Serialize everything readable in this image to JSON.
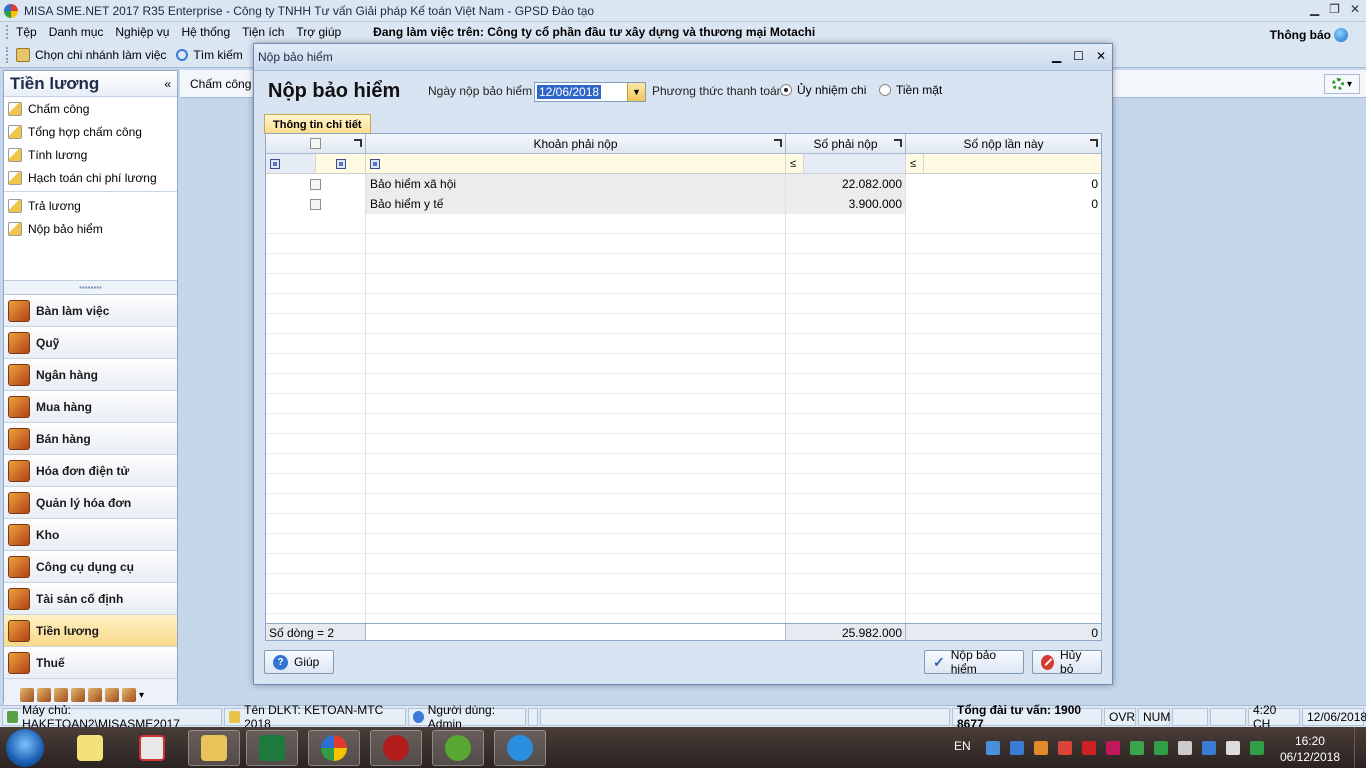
{
  "window": {
    "title": "MISA SME.NET 2017 R35 Enterprise - Công ty TNHH Tư vấn Giải pháp Kế toán Việt Nam - GPSD Đào tạo"
  },
  "menu": {
    "items": [
      "Tệp",
      "Danh mục",
      "Nghiệp vụ",
      "Hệ thống",
      "Tiện ích",
      "Trợ giúp"
    ],
    "workspace": "Đang làm việc trên:  Công ty cổ phần đầu tư xây dựng và thương mại Motachi",
    "notifications": "Thông báo"
  },
  "toolbar": {
    "branch": "Chọn chi nhánh làm việc",
    "search": "Tìm kiếm"
  },
  "sidebar": {
    "title": "Tiền lương",
    "collapse": "«",
    "items": [
      "Chấm công",
      "Tổng hợp chấm công",
      "Tính lương",
      "Hạch toán chi phí lương",
      "Trả lương",
      "Nộp bảo hiểm"
    ],
    "modules": [
      "Bàn làm việc",
      "Quỹ",
      "Ngân hàng",
      "Mua hàng",
      "Bán hàng",
      "Hóa đơn điện tử",
      "Quản lý hóa đơn",
      "Kho",
      "Công cụ dụng cụ",
      "Tài sản cố định",
      "Tiền lương",
      "Thuế"
    ],
    "active_module": "Tiền lương"
  },
  "main": {
    "tab": "Chấm công"
  },
  "dialog": {
    "window_title": "Nộp bảo hiểm",
    "heading": "Nộp bảo hiểm",
    "date_label": "Ngày nộp bảo hiểm",
    "date_value": "12/06/2018",
    "payment_label": "Phương thức thanh toán",
    "payment_options": [
      "Ủy nhiệm chi",
      "Tiền mặt"
    ],
    "payment_selected": "Ủy nhiệm chi",
    "tab": "Thông tin chi tiết",
    "grid": {
      "columns": [
        "Khoản phải nộp",
        "Số phải nộp",
        "Số nộp lần này"
      ],
      "filter_symbol": "≤",
      "rows": [
        {
          "item": "Bảo hiểm xã hội",
          "amount_due": "22.082.000",
          "amount_now": "0"
        },
        {
          "item": "Bảo hiểm y tế",
          "amount_due": "3.900.000",
          "amount_now": "0"
        }
      ],
      "footer": {
        "row_count": "Số dòng = 2",
        "total_due": "25.982.000",
        "total_now": "0"
      }
    },
    "buttons": {
      "help": "Giúp",
      "submit": "Nộp bảo hiểm",
      "cancel": "Hủy bỏ"
    }
  },
  "statusbar": {
    "server": "Máy chủ: HAKETOAN2\\MISASME2017",
    "db": "Tên DLKT: KETOAN-MTC 2018",
    "user": "Người dùng: Admin",
    "hotline": "Tổng đài tư vấn: 1900 8677",
    "ovr": "OVR",
    "num": "NUM",
    "time": "4:20 CH",
    "date": "12/06/2018"
  },
  "taskbar": {
    "lang": "EN",
    "clock_time": "16:20",
    "clock_date": "06/12/2018"
  }
}
